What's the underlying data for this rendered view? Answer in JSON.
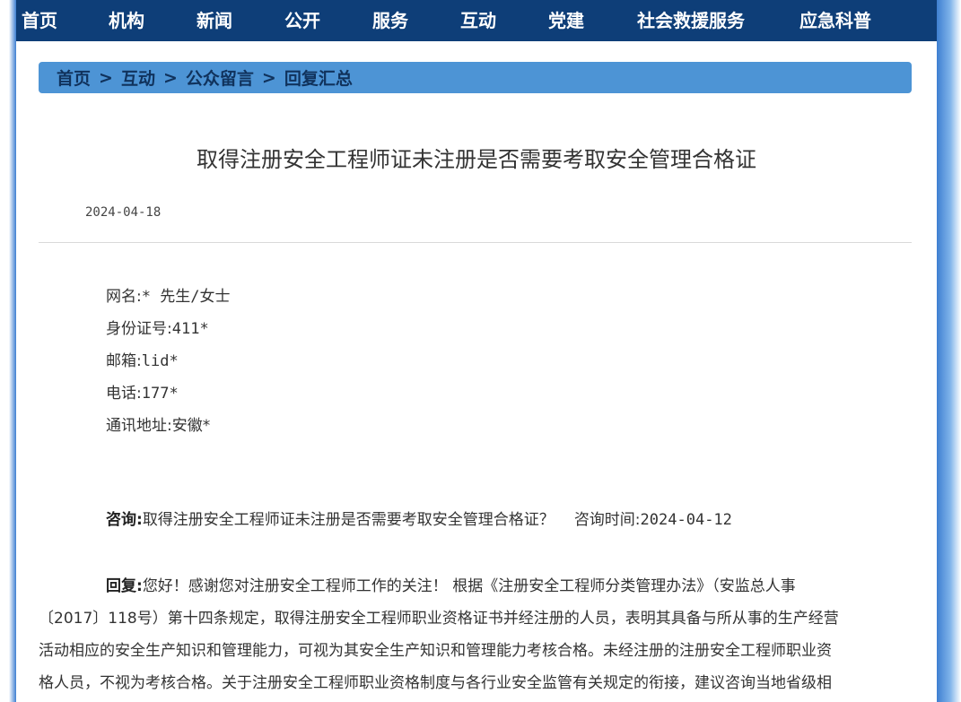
{
  "nav": {
    "items": [
      "首页",
      "机构",
      "新闻",
      "公开",
      "服务",
      "互动",
      "党建",
      "社会救援服务",
      "应急科普"
    ]
  },
  "breadcrumb": {
    "items": [
      "首页",
      "互动",
      "公众留言",
      "回复汇总"
    ],
    "separator": ">"
  },
  "article": {
    "title": "取得注册安全工程师证未注册是否需要考取安全管理合格证",
    "date": "2024-04-18"
  },
  "info": {
    "name_label": "网名:",
    "name_value": "* 先生/女士",
    "id_label": "身份证号:",
    "id_value": "411*",
    "email_label": "邮箱:",
    "email_value": "lid*",
    "phone_label": "电话:",
    "phone_value": "177*",
    "address_label": "通讯地址:",
    "address_value": "安徽*"
  },
  "consult": {
    "label": "咨询:",
    "question": "取得注册安全工程师证未注册是否需要考取安全管理合格证？",
    "time_label": "咨询时间:",
    "time_value": "2024-04-12"
  },
  "reply": {
    "label": "回复:",
    "lines": [
      "您好！感谢您对注册安全工程师工作的关注！ 根据《注册安全工程师分类管理办法》（安监总人事",
      "〔2017〕118号）第十四条规定，取得注册安全工程师职业资格证书并经注册的人员，表明其具备与所从事的生产经营",
      "活动相应的安全生产知识和管理能力，可视为其安全生产知识和管理能力考核合格。未经注册的注册安全工程师职业资",
      "格人员，不视为考核合格。关于注册安全工程师职业资格制度与各行业安全监管有关规定的衔接，建议咨询当地省级相"
    ]
  },
  "colors": {
    "nav_bg": "#0e3e78",
    "breadcrumb_bg": "#4d94d5",
    "breadcrumb_text": "#10325c"
  }
}
